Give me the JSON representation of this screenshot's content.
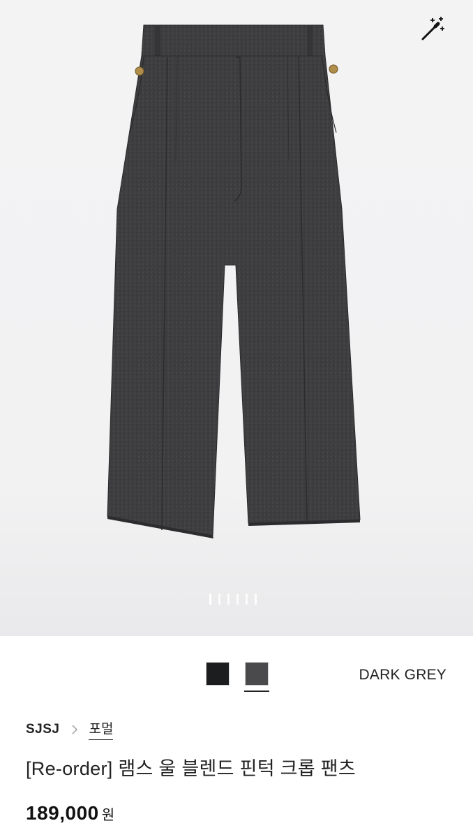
{
  "product": {
    "image_alt": "Dark grey wool blend pintuck cropped pants",
    "carousel": {
      "count": 6,
      "active_index": 0
    },
    "colors": [
      {
        "name": "BLACK",
        "hex": "#1c1d1f"
      },
      {
        "name": "DARK GREY",
        "hex": "#4a4a4c"
      }
    ],
    "selected_color_index": 1,
    "selected_color_label": "DARK GREY",
    "brand": "SJSJ",
    "category": "포멀",
    "title": "[Re-order] 램스 울 블렌드 핀턱 크롭 팬츠",
    "price": "189,000",
    "currency": "원"
  },
  "icons": {
    "magic": "magic-wand-icon",
    "breadcrumb_separator": "chevron-right-icon"
  },
  "colors": {
    "fabric": "#3f3f41",
    "fabric_dark": "#2f2f31",
    "background": "#f2f2f3",
    "text": "#222222"
  }
}
